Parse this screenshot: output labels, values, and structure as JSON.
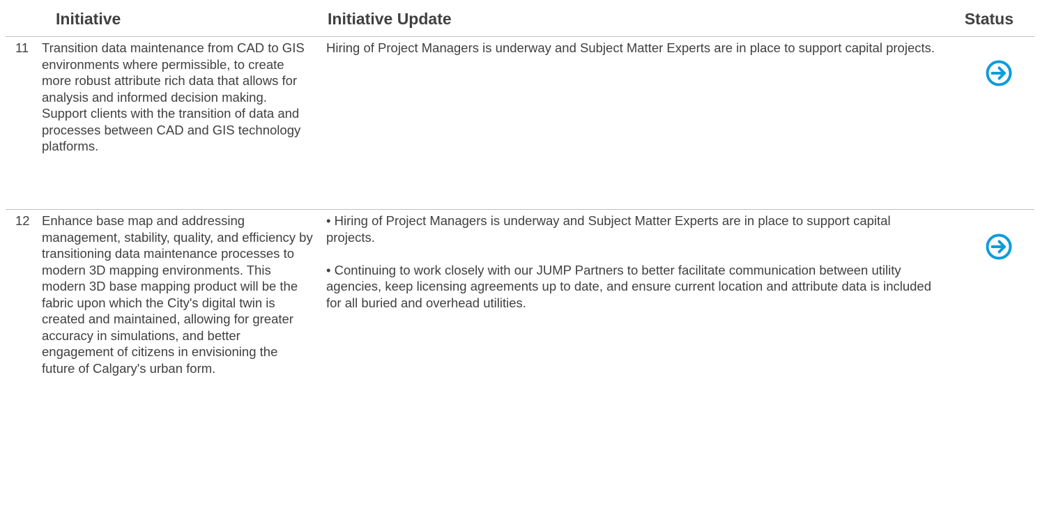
{
  "header": {
    "initiative": "Initiative",
    "update": "Initiative Update",
    "status": "Status"
  },
  "rows": [
    {
      "number": "11",
      "initiative": "Transition data maintenance from CAD to GIS environments where permissible, to create more robust attribute rich data that allows for analysis and informed decision making. Support clients with the transition of data and processes between CAD and GIS technology platforms.",
      "updates": [
        "Hiring of Project Managers is underway and Subject Matter Experts are in place to support capital projects."
      ],
      "status_icon": "arrow-right-circle-icon"
    },
    {
      "number": "12",
      "initiative": "Enhance base map and addressing management, stability, quality, and efficiency by transitioning data maintenance processes to modern 3D mapping environments. This modern 3D base mapping product will be the fabric upon which the City's digital twin is created and maintained, allowing for greater accuracy in simulations, and better engagement of citizens in envisioning the future of Calgary's urban form.",
      "updates": [
        "• Hiring of Project Managers is underway and Subject Matter Experts are in place to support capital projects.",
        "• Continuing to work closely with our JUMP Partners to better facilitate communication between utility agencies, keep licensing agreements up to date, and ensure current location and attribute data is included for all buried and overhead utilities."
      ],
      "status_icon": "arrow-right-circle-icon"
    }
  ],
  "colors": {
    "status_icon": "#0d9ddb",
    "text": "#404040",
    "rule": "#bfbfbf"
  }
}
